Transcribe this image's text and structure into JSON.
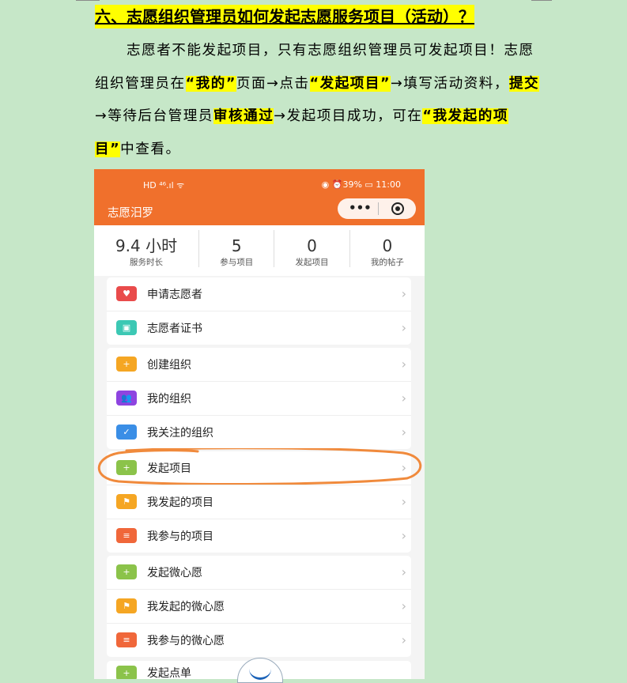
{
  "heading": "六、志愿组织管理员如何发起志愿服务项目（活动）？",
  "para": {
    "s1": "志愿者不能发起项目，只有志愿组织管理员可发起项目！志愿组织管理员在",
    "h1": "“我的”",
    "s2": "页面→点击",
    "h2": "“发起项目”",
    "s3": "→填写活动资料，",
    "h3": "提交",
    "s4": "→等待后台管理员",
    "h4": "审核通过",
    "s5": "→发起项目成功，可在",
    "h5": "“我发起的项目”",
    "s6": "中查看。"
  },
  "phone": {
    "status_left": "HD ⁴⁶.ıl ᯤ",
    "status_right": "◉ ⏰39% ▭ 11:00",
    "title": "志愿汨罗",
    "capsule_more": "•••",
    "stats": [
      {
        "value": "9.4 小时",
        "label": "服务时长"
      },
      {
        "value": "5",
        "label": "参与项目"
      },
      {
        "value": "0",
        "label": "发起项目"
      },
      {
        "value": "0",
        "label": "我的帖子"
      }
    ],
    "groups": [
      [
        {
          "label": "申请志愿者",
          "icon": "heart-icon",
          "color": "#e94b4b",
          "glyph": "♥"
        },
        {
          "label": "志愿者证书",
          "icon": "certificate-icon",
          "color": "#3cc8b4",
          "glyph": "▣"
        }
      ],
      [
        {
          "label": "创建组织",
          "icon": "create-org-icon",
          "color": "#f5a623",
          "glyph": "+"
        },
        {
          "label": "我的组织",
          "icon": "people-icon",
          "color": "#8e44e0",
          "glyph": "👥"
        },
        {
          "label": "我关注的组织",
          "icon": "follow-icon",
          "color": "#3a8ee6",
          "glyph": "✓"
        }
      ],
      [
        {
          "label": "发起项目",
          "icon": "add-circle-icon",
          "color": "#8bc34a",
          "glyph": "+"
        },
        {
          "label": "我发起的项目",
          "icon": "flag-icon",
          "color": "#f5a623",
          "glyph": "⚑"
        },
        {
          "label": "我参与的项目",
          "icon": "list-icon",
          "color": "#f0673a",
          "glyph": "≡"
        }
      ],
      [
        {
          "label": "发起微心愿",
          "icon": "add-circle-icon",
          "color": "#8bc34a",
          "glyph": "+"
        },
        {
          "label": "我发起的微心愿",
          "icon": "flag-icon",
          "color": "#f5a623",
          "glyph": "⚑"
        },
        {
          "label": "我参与的微心愿",
          "icon": "list-icon",
          "color": "#f0673a",
          "glyph": "≡"
        }
      ]
    ],
    "peek_label": "发起点单",
    "annotation_color": "#f08a3c"
  }
}
